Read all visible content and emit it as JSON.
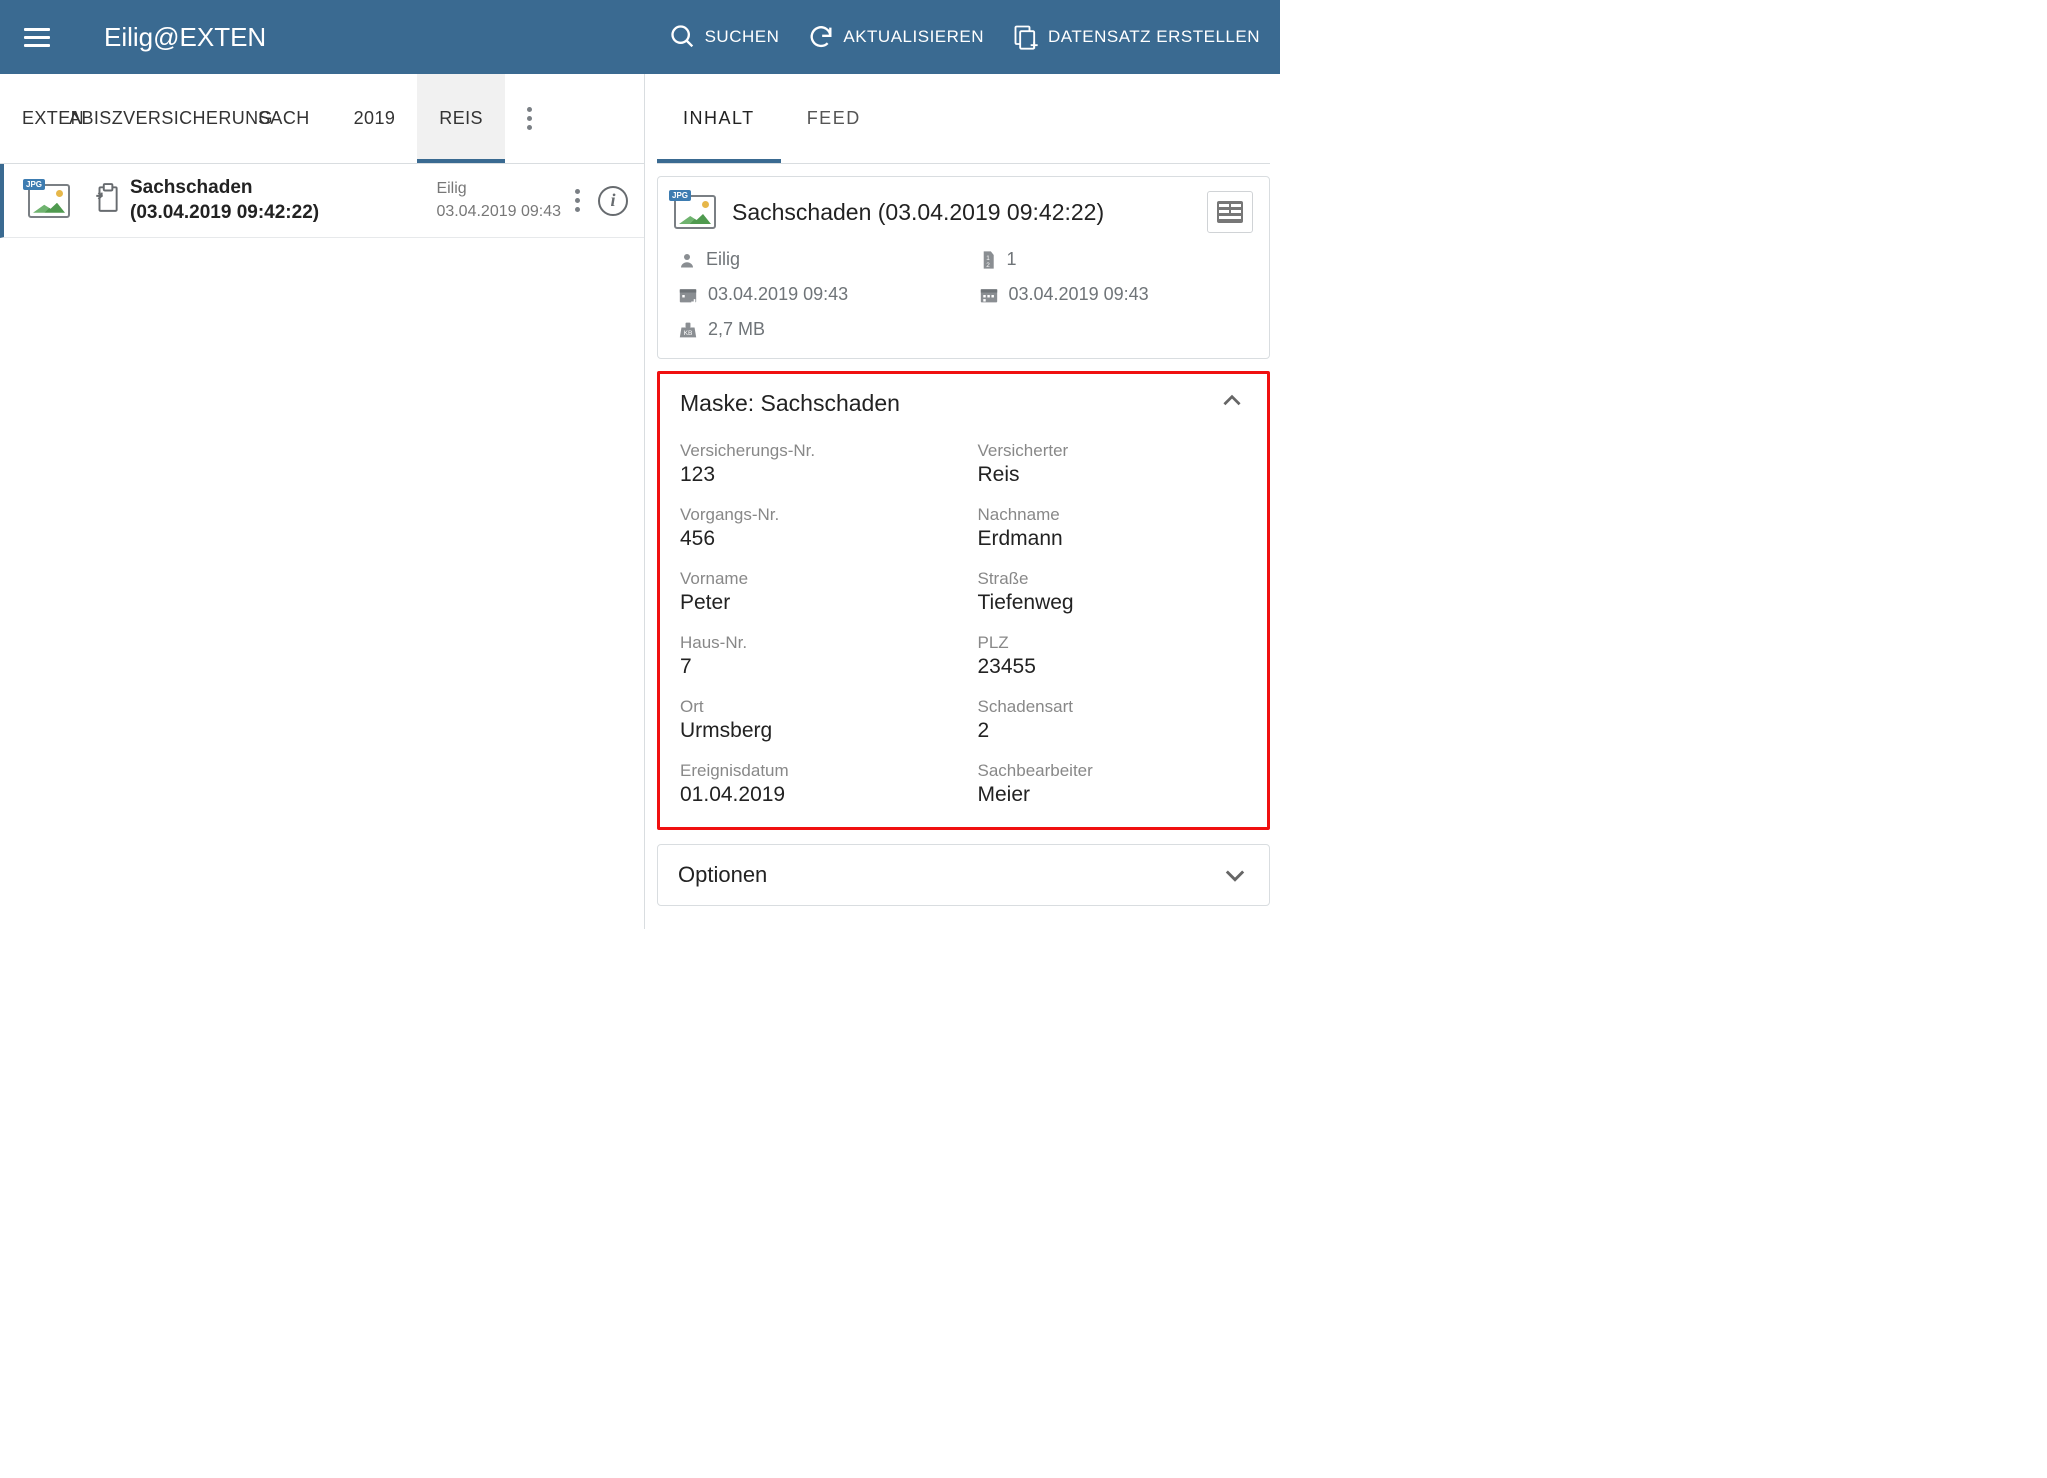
{
  "header": {
    "app_title": "Eilig@EXTEN",
    "search_label": "SUCHEN",
    "refresh_label": "AKTUALISIEREN",
    "new_label": "DATENSATZ ERSTELLEN"
  },
  "breadcrumb_tabs": [
    {
      "label": "EXTEN"
    },
    {
      "label": "ABISZVERSICHERUNG"
    },
    {
      "label": "SACH"
    },
    {
      "label": "2019"
    },
    {
      "label": "REIS"
    }
  ],
  "doc_row": {
    "title_line1": "Sachschaden",
    "title_line2": "(03.04.2019 09:42:22)",
    "owner": "Eilig",
    "timestamp": "03.04.2019 09:43"
  },
  "right_tabs": {
    "content": "INHALT",
    "feed": "FEED"
  },
  "summary": {
    "title": "Sachschaden (03.04.2019 09:42:22)",
    "owner": "Eilig",
    "version": "1",
    "created": "03.04.2019 09:43",
    "modified": "03.04.2019 09:43",
    "size": "2,7 MB"
  },
  "mask": {
    "heading": "Maske: Sachschaden",
    "fields": [
      {
        "label": "Versicherungs-Nr.",
        "value": "123"
      },
      {
        "label": "Versicherter",
        "value": "Reis"
      },
      {
        "label": "Vorgangs-Nr.",
        "value": "456"
      },
      {
        "label": "Nachname",
        "value": "Erdmann"
      },
      {
        "label": "Vorname",
        "value": "Peter"
      },
      {
        "label": "Straße",
        "value": "Tiefenweg"
      },
      {
        "label": "Haus-Nr.",
        "value": "7"
      },
      {
        "label": "PLZ",
        "value": "23455"
      },
      {
        "label": "Ort",
        "value": "Urmsberg"
      },
      {
        "label": "Schadensart",
        "value": "2"
      },
      {
        "label": "Ereignisdatum",
        "value": "01.04.2019"
      },
      {
        "label": "Sachbearbeiter",
        "value": "Meier"
      }
    ]
  },
  "options": {
    "label": "Optionen"
  }
}
